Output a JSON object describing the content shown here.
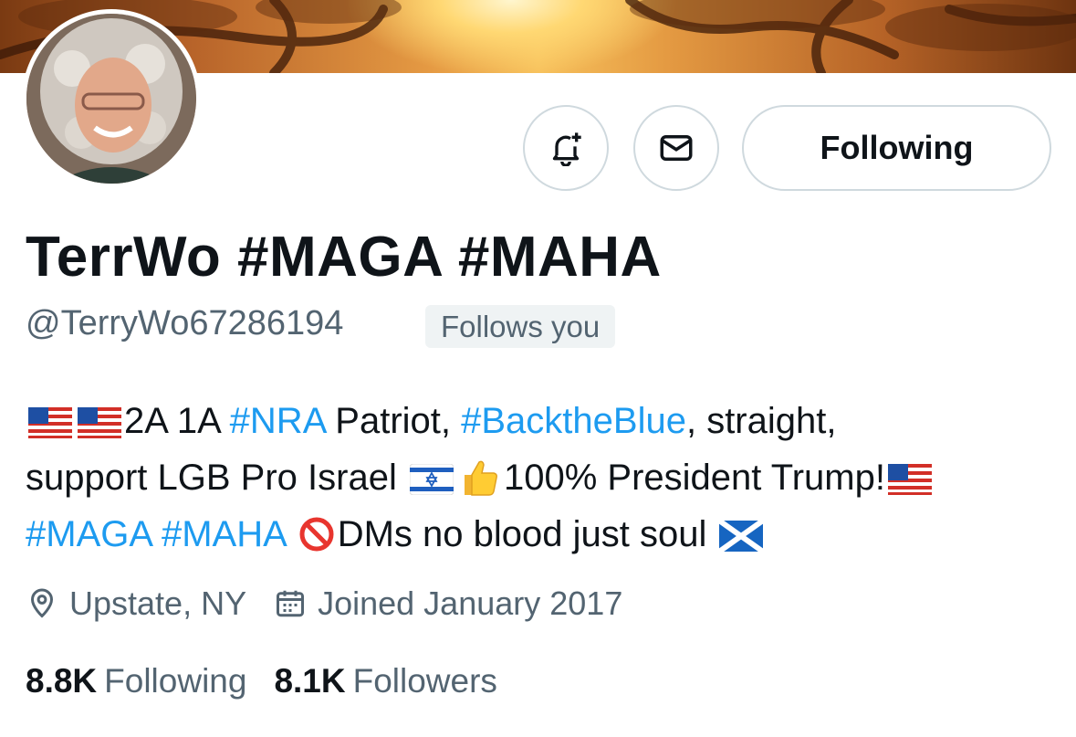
{
  "profile": {
    "display_name": "TerrWo #MAGA #MAHA",
    "handle": "@TerryWo67286194",
    "follows_badge": "Follows you"
  },
  "actions": {
    "notify_icon": "bell-plus-icon",
    "message_icon": "envelope-icon",
    "following_label": "Following"
  },
  "bio": {
    "line1_text_a": "2A 1A ",
    "line1_tag_a": "#NRA",
    "line1_text_b": " Patriot, ",
    "line1_tag_b": "#BacktheBlue",
    "line1_text_c": ", straight,",
    "line2_text_a": "support LGB Pro Israel ",
    "line2_text_b": "100% President Trump!",
    "line3_tag_a": "#MAGA",
    "line3_tag_b": "#MAHA",
    "line3_text_a": "DMs no blood just soul "
  },
  "meta": {
    "location": "Upstate, NY",
    "joined": "Joined January 2017"
  },
  "stats": {
    "following_count": "8.8K",
    "following_label": "Following",
    "followers_count": "8.1K",
    "followers_label": "Followers"
  },
  "colors": {
    "link": "#1d9bf0",
    "secondary_text": "#536471",
    "border": "#cfd9de"
  }
}
